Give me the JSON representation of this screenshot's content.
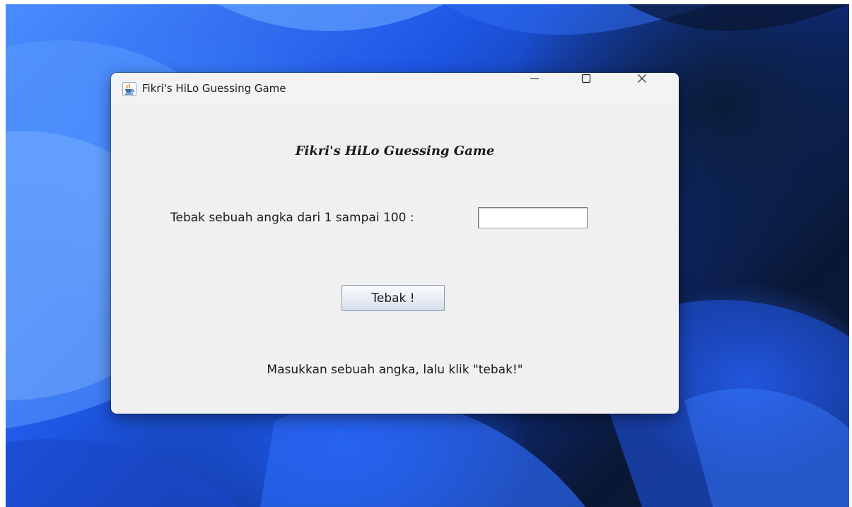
{
  "window": {
    "title": "Fikri's HiLo Guessing Game",
    "icon": "java-coffee-cup-icon"
  },
  "title_controls": {
    "minimize_icon": "minimize-icon",
    "maximize_icon": "maximize-icon",
    "close_icon": "close-icon"
  },
  "content": {
    "heading": "Fikri's HiLo Guessing Game",
    "prompt_label": "Tebak sebuah angka dari 1 sampai 100 :",
    "guess_input_value": "",
    "guess_button_label": "Tebak !",
    "status_message": "Masukkan sebuah angka, lalu klik \"tebak!\""
  },
  "colors": {
    "window_bg": "#f0f0f0",
    "button_border": "#8a9bb0",
    "desktop_accent": "#1e57e6"
  }
}
